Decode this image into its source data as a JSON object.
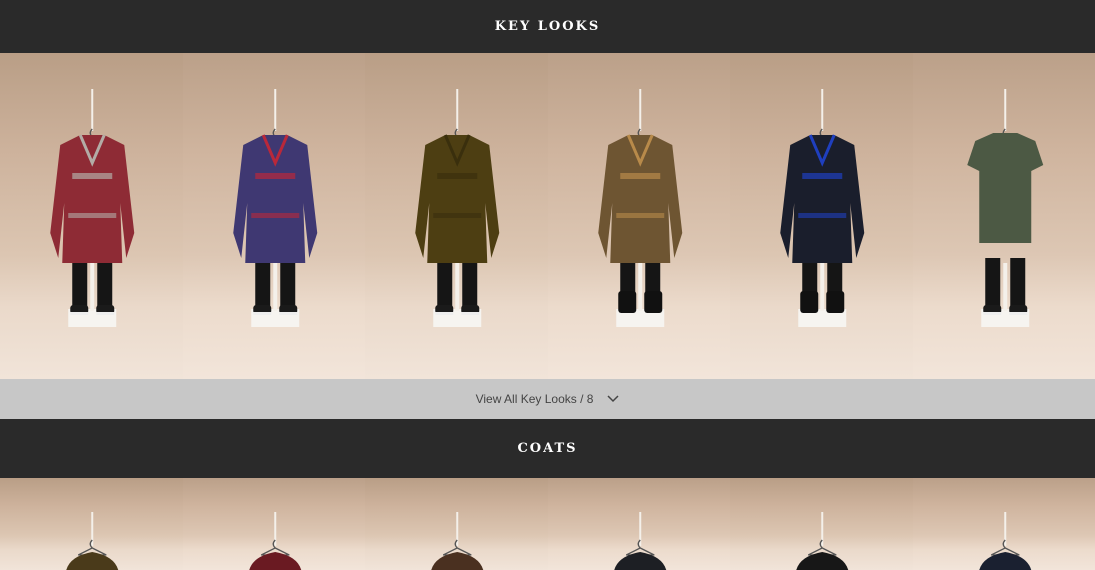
{
  "key_looks": {
    "title": "KEY LOOKS",
    "view_all_label": "View All Key Looks / 8",
    "looks": [
      {
        "garment": "red-patterned-coat",
        "color": "#8e2b35",
        "accent": "#b3aca6",
        "boots": false
      },
      {
        "garment": "blue-floral-coat",
        "color": "#3f3872",
        "accent": "#b9283a",
        "boots": false
      },
      {
        "garment": "olive-duffle-coat",
        "color": "#4d3e12",
        "accent": "#3a2f0d",
        "boots": false
      },
      {
        "garment": "check-shirt-jacket",
        "color": "#6e5532",
        "accent": "#b88a4a",
        "boots": true
      },
      {
        "garment": "navy-pea-coat",
        "color": "#1a1e2c",
        "accent": "#1f3fbf",
        "boots": true
      },
      {
        "garment": "green-t-shirt",
        "color": "#4c5944",
        "accent": "#3e4a38",
        "boots": false
      }
    ]
  },
  "coats": {
    "title": "COATS",
    "items": [
      {
        "garment": "olive-coat",
        "color": "#4a3a1a"
      },
      {
        "garment": "burgundy-coat",
        "color": "#6a1a22"
      },
      {
        "garment": "brown-coat",
        "color": "#4a3020"
      },
      {
        "garment": "black-coat",
        "color": "#1d1f24"
      },
      {
        "garment": "dark-coat",
        "color": "#171717"
      },
      {
        "garment": "navy-coat",
        "color": "#1a2030"
      }
    ]
  }
}
